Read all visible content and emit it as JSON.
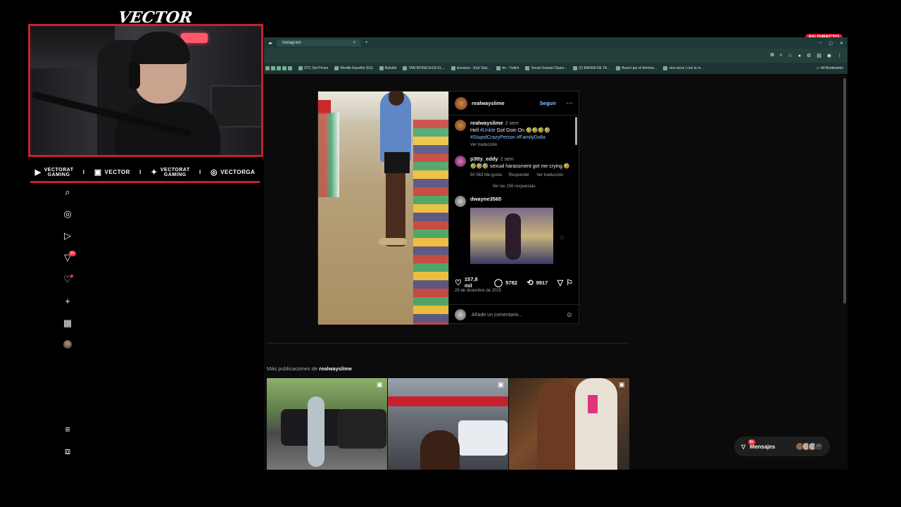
{
  "stream": {
    "brand": "VECTOR",
    "live_badge": "EN DIRECTO",
    "socials": [
      {
        "icon": "youtube-icon",
        "line1": "VECTORAT",
        "line2": "GAMING"
      },
      {
        "icon": "twitch-icon",
        "label": "VECTOR"
      },
      {
        "icon": "twitter-icon",
        "line1": "VECTORAT",
        "line2": "GAMING"
      },
      {
        "icon": "instagram-icon",
        "label": "VECTORGA"
      }
    ],
    "separator": "I"
  },
  "browser": {
    "tab_title": "Instagram",
    "tab_close": "×",
    "new_tab": "+",
    "window_controls": [
      "–",
      "▢",
      "✕"
    ],
    "bookmarks": [
      "STC Set Prices",
      "Wordle Español (ES)",
      "Boludle",
      "TAN BIONICA EN EL...",
      "sionaron - Kick Stat...",
      "tm - Twitch",
      "Tenuki Sunset Classi...",
      "(2) BARRA DE TA...",
      "Buscó por el término...",
      "cion arros | con la m..."
    ],
    "all_bookmarks": "All Bookmarks"
  },
  "sidebar": {
    "icons": [
      "search-icon",
      "explore-icon",
      "reels-icon",
      "direct-icon",
      "notifications-icon",
      "create-icon",
      "dashboard-icon",
      "profile-avatar"
    ],
    "bottom_icons": [
      "menu-icon",
      "threads-icon"
    ],
    "direct_badge": "9+"
  },
  "post": {
    "username": "realwayslime",
    "follow": "Seguir",
    "more": "···",
    "caption": {
      "username": "realwayslime",
      "time": "2 sem",
      "text_prefix": "Hell ",
      "tag1": "#Unkle",
      "text_mid": " Got Goin On 🤣🤣🤣🤣",
      "tags": "#StupidCrazyPerson #FamilyDolla",
      "translate": "Ver traducción"
    },
    "comments": [
      {
        "username": "p3tty_eddy",
        "time": "2 sem",
        "text": "🤣🤣🤣 sexual harassment got me crying 🤣",
        "likes": "50 563 Me gusta",
        "reply": "Responder",
        "translate": "Ver traducción",
        "view_replies": "Ver las 156 respuestas"
      },
      {
        "username": "dwayne3565"
      }
    ],
    "like_count": "157,8 mil",
    "comment_count": "5782",
    "repost_count": "9917",
    "date": "29 de diciembre de 2025",
    "add_comment_placeholder": "Añade un comentario...",
    "more_from_prefix": "Más publicaciones de ",
    "more_from_user": "realwayslime"
  },
  "messages": {
    "label": "Mensajes",
    "badge": "9+"
  }
}
